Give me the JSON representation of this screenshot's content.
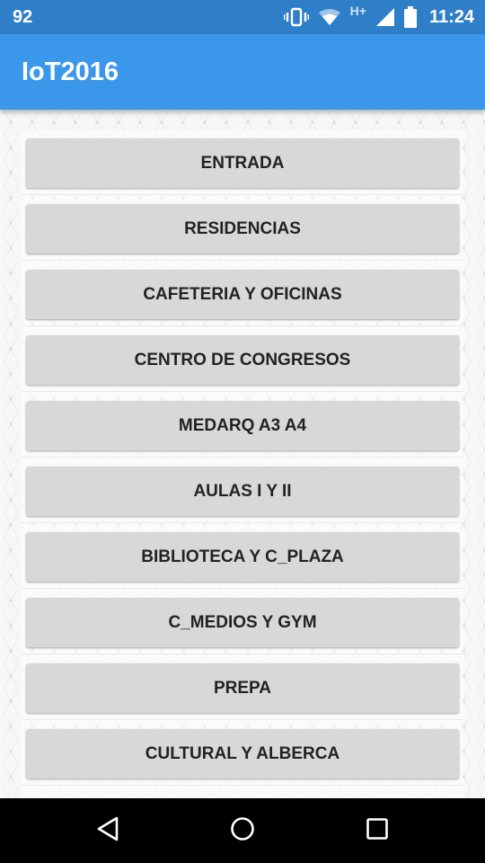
{
  "status_bar": {
    "notification": "92",
    "network_label": "H+",
    "time": "11:24",
    "icons": [
      "vibrate-icon",
      "wifi-icon",
      "cellular-signal-icon",
      "battery-icon"
    ]
  },
  "app_bar": {
    "title": "IoT2016"
  },
  "locations": [
    {
      "label": "ENTRADA"
    },
    {
      "label": "RESIDENCIAS"
    },
    {
      "label": "CAFETERIA Y OFICINAS"
    },
    {
      "label": "CENTRO DE CONGRESOS"
    },
    {
      "label": "MEDARQ A3 A4"
    },
    {
      "label": "AULAS I Y II"
    },
    {
      "label": "BIBLIOTECA Y C_PLAZA"
    },
    {
      "label": "C_MEDIOS Y GYM"
    },
    {
      "label": "PREPA"
    },
    {
      "label": "CULTURAL Y ALBERCA"
    }
  ],
  "nav_bar": {
    "icons": [
      "back-icon",
      "home-icon",
      "recents-icon"
    ]
  },
  "colors": {
    "status_bar": "#2f7fc8",
    "app_bar": "#3a97ea",
    "button": "#d8d8d8",
    "nav_bar": "#000000"
  }
}
